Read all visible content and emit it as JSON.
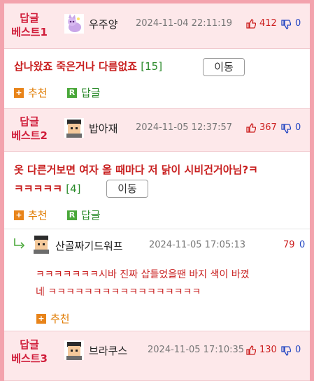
{
  "icons": {
    "thumb_up": "thumbs-up-icon",
    "thumb_down": "thumbs-down-icon",
    "recommend": "plus-square-icon",
    "reply": "r-square-icon",
    "reply_arrow": "reply-arrow-icon"
  },
  "colors": {
    "frame": "#f3a3ad",
    "header_bg": "#fde8ea",
    "rank": "#d01d3a",
    "content": "#c81e1e",
    "up": "#cc1f1f",
    "down": "#2346c2"
  },
  "actions": {
    "recommend": "추천",
    "reply": "답글",
    "move": "이동"
  },
  "posts": [
    {
      "rank_top": "답글",
      "rank_bottom": "베스트1",
      "nickname": "우주양",
      "date": "2024-11-04 22:11:19",
      "up": "412",
      "down": "0",
      "content": "삽나왔죠 죽은거나 다름없죠",
      "count": "[15]"
    },
    {
      "rank_top": "답글",
      "rank_bottom": "베스트2",
      "nickname": "밥아재",
      "date": "2024-11-05 12:37:57",
      "up": "367",
      "down": "0",
      "content_line1": "옷 다른거보면 여자 올 때마다 저 닭이 시비건거아님?ㅋ",
      "content_line2": "ㅋㅋㅋㅋㅋ",
      "count": "[4]"
    },
    {
      "rank_top": "답글",
      "rank_bottom": "베스트3",
      "nickname": "브라쿠스",
      "date": "2024-11-05 17:10:35",
      "up": "130",
      "down": "0"
    }
  ],
  "reply": {
    "nickname": "산골짜기드워프",
    "date": "2024-11-05 17:05:13",
    "up": "79",
    "down": "0",
    "line1": "ㅋㅋㅋㅋㅋㅋㅋ시바 진짜 삽들었을땐 바지 색이 바꼈",
    "line2": "네 ㅋㅋㅋㅋㅋㅋㅋㅋㅋㅋㅋㅋㅋㅋㅋㅋㅋ"
  }
}
